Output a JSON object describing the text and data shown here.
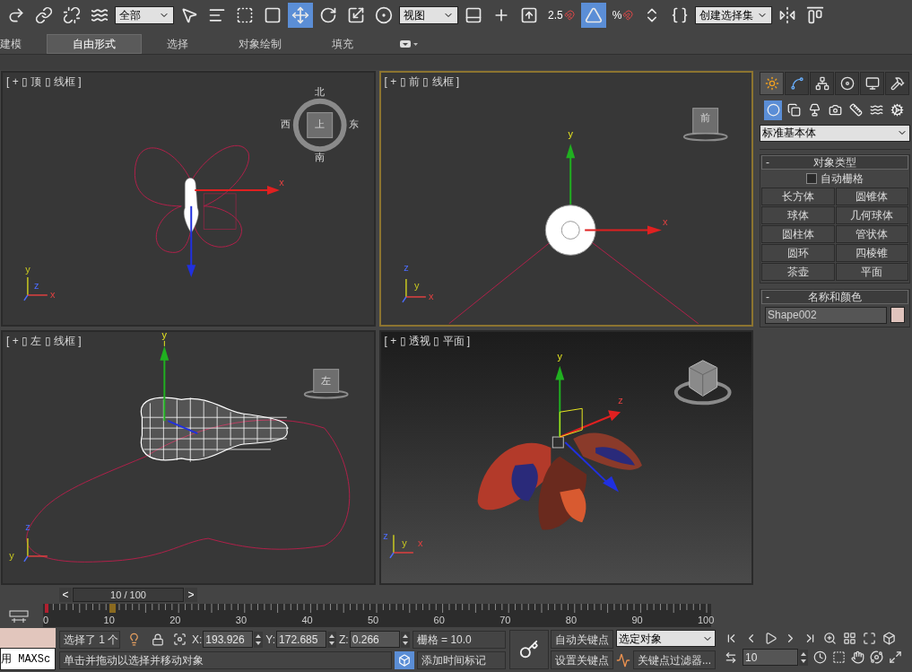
{
  "toolbar": [
    {
      "kind": "button",
      "selected": false
    },
    {
      "kind": "button",
      "selected": false
    },
    {
      "kind": "button",
      "selected": false
    },
    {
      "kind": "button",
      "selected": false
    },
    {
      "kind": "dropdown",
      "value": "全部"
    },
    {
      "kind": "button",
      "selected": false
    },
    {
      "kind": "button",
      "selected": false
    },
    {
      "kind": "button",
      "selected": false
    },
    {
      "kind": "button",
      "selected": false
    },
    {
      "kind": "button",
      "selected": true
    },
    {
      "kind": "button",
      "selected": false
    },
    {
      "kind": "button",
      "selected": false
    },
    {
      "kind": "button",
      "selected": false
    },
    {
      "kind": "dropdown",
      "value": "视图"
    },
    {
      "kind": "button",
      "selected": false
    },
    {
      "kind": "button",
      "selected": false
    },
    {
      "kind": "button",
      "selected": false
    },
    {
      "kind": "snap",
      "label": "2.5",
      "selected": false
    },
    {
      "kind": "button",
      "selected": true
    },
    {
      "kind": "snap",
      "label": "%",
      "selected": false
    },
    {
      "kind": "button",
      "selected": false
    },
    {
      "kind": "button",
      "selected": false
    },
    {
      "kind": "dropdown",
      "value": "创建选择集"
    },
    {
      "kind": "button",
      "selected": false
    },
    {
      "kind": "button",
      "selected": false
    }
  ],
  "ribbon_tabs": [
    {
      "label": "建模",
      "selected": false
    },
    {
      "label": "自由形式",
      "selected": true
    },
    {
      "label": "选择",
      "selected": false
    },
    {
      "label": "对象绘制",
      "selected": false
    },
    {
      "label": "填充",
      "selected": false
    }
  ],
  "viewports": [
    {
      "label": "[ + ▯ 顶 ▯ 线框 ]",
      "selected": false,
      "cube_labels": [
        "北",
        "西",
        "上",
        "东",
        "南"
      ],
      "gizmo_labels": [
        "x"
      ],
      "tripod_labels": [
        "y",
        "z",
        "x"
      ]
    },
    {
      "label": "[ + ▯ 前 ▯ 线框 ]",
      "selected": true,
      "cube_labels": [
        "前"
      ],
      "gizmo_labels": [
        "y",
        "x"
      ],
      "tripod_labels": [
        "z",
        "y",
        "x"
      ]
    },
    {
      "label": "[ + ▯ 左 ▯ 线框 ]",
      "selected": false,
      "cube_labels": [
        "左"
      ],
      "gizmo_labels": [
        "y"
      ],
      "tripod_labels": [
        "z",
        "y"
      ]
    },
    {
      "label": "[ + ▯ 透视 ▯ 平面 ]",
      "selected": false,
      "gizmo_labels": [
        "y",
        "z"
      ],
      "tripod_labels": [
        "z",
        "y",
        "x"
      ]
    }
  ],
  "command_panel": {
    "tabs": [
      {
        "selected": true
      },
      {
        "selected": false
      },
      {
        "selected": false
      },
      {
        "selected": false
      },
      {
        "selected": false
      },
      {
        "selected": false
      }
    ],
    "categories": [
      {
        "selected": true
      },
      {
        "selected": false
      },
      {
        "selected": false
      },
      {
        "selected": false
      },
      {
        "selected": false
      },
      {
        "selected": false
      },
      {
        "selected": false
      }
    ],
    "dropdown": "标准基本体",
    "object_type": {
      "collapse": "-",
      "title": "对象类型",
      "autogrid": {
        "label": "自动栅格",
        "checked": false
      },
      "buttons": [
        "长方体",
        "圆锥体",
        "球体",
        "几何球体",
        "圆柱体",
        "管状体",
        "圆环",
        "四棱锥",
        "茶壶",
        "平面"
      ]
    },
    "name_color": {
      "collapse": "-",
      "title": "名称和颜色",
      "name": "Shape002",
      "color": "#e0c4bd"
    }
  },
  "timeline": {
    "prev": "<",
    "position": "10 / 100",
    "next": ">",
    "level": 0.1,
    "ticks": [
      "0",
      "10",
      "20",
      "30",
      "40",
      "50",
      "60",
      "70",
      "80",
      "90",
      "100"
    ]
  },
  "status": {
    "maxscript": "用 MAXSc",
    "selection": "选择了 1 个",
    "coords": [
      {
        "axis": "X:",
        "value": "193.926"
      },
      {
        "axis": "Y:",
        "value": "172.685"
      },
      {
        "axis": "Z:",
        "value": "0.266"
      }
    ],
    "grid": "栅格 = 10.0",
    "prompt": "单击并拖动以选择并移动对象",
    "add_tag": "添加时间标记",
    "auto_key": "自动关键点",
    "set_key": "设置关键点",
    "key_mode": "选定对象",
    "key_filters": "关键点过滤器...",
    "frame": "10"
  }
}
